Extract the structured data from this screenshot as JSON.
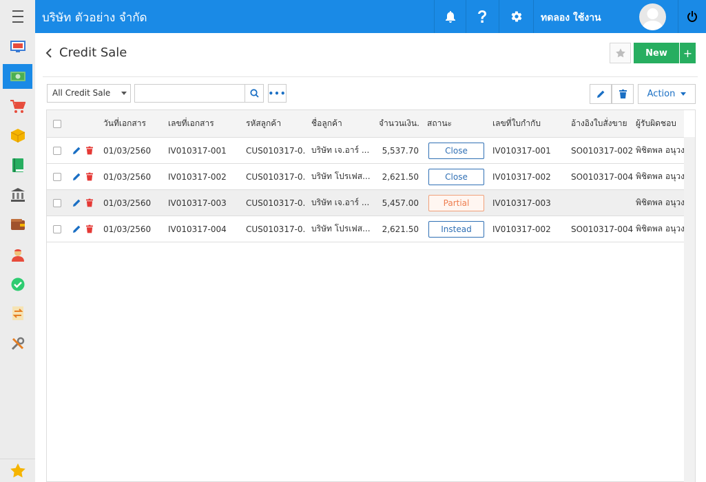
{
  "header": {
    "company": "บริษัท ตัวอย่าง จำกัด",
    "username": "ทดลอง ใช้งาน",
    "icons": [
      "bell-icon",
      "help-icon",
      "gear-icon",
      "power-icon"
    ],
    "color": "#1a8ae6"
  },
  "sidebar": {
    "items": [
      "dashboard-icon",
      "money-icon",
      "cart-icon",
      "box-icon",
      "book-icon",
      "bank-icon",
      "wallet-icon",
      "person-icon",
      "check-icon",
      "transfer-icon",
      "tools-icon"
    ],
    "active_index": 1,
    "bottom": "star-icon"
  },
  "page": {
    "title": "Credit Sale",
    "new_label": "New",
    "plus_label": "+"
  },
  "toolbar": {
    "filter_value": "All Credit Sale",
    "search_placeholder": "",
    "more_label": "•••",
    "action_label": "Action"
  },
  "table": {
    "headers": [
      "วันที่เอกสาร",
      "เลขที่เอกสาร",
      "รหัสลูกค้า",
      "ชื่อลูกค้า",
      "จำนวนเงิน...",
      "สถานะ",
      "เลขที่ใบกำกับ",
      "อ้างอิงใบสั่งขาย",
      "ผู้รับผิดชอบ"
    ],
    "rows": [
      {
        "date": "01/03/2560",
        "doc_no": "IV010317-001",
        "cust_code": "CUS010317-0...",
        "cust_name": "บริษัท เจ.อาร์ ...",
        "amount": "5,537.70",
        "status": "Close",
        "invoice": "IV010317-001",
        "so_ref": "SO010317-002",
        "owner": "พิชิตพล อนุวง"
      },
      {
        "date": "01/03/2560",
        "doc_no": "IV010317-002",
        "cust_code": "CUS010317-0...",
        "cust_name": "บริษัท โปรเฟส...",
        "amount": "2,621.50",
        "status": "Close",
        "invoice": "IV010317-002",
        "so_ref": "SO010317-004",
        "owner": "พิชิตพล อนุวง"
      },
      {
        "date": "01/03/2560",
        "doc_no": "IV010317-003",
        "cust_code": "CUS010317-0...",
        "cust_name": "บริษัท เจ.อาร์ ...",
        "amount": "5,457.00",
        "status": "Partial",
        "invoice": "IV010317-003",
        "so_ref": "",
        "owner": "พิชิตพล อนุวง"
      },
      {
        "date": "01/03/2560",
        "doc_no": "IV010317-004",
        "cust_code": "CUS010317-0...",
        "cust_name": "บริษัท โปรเฟส...",
        "amount": "2,621.50",
        "status": "Instead",
        "invoice": "IV010317-002",
        "so_ref": "SO010317-004",
        "owner": "พิชิตพล อนุวง"
      }
    ]
  }
}
